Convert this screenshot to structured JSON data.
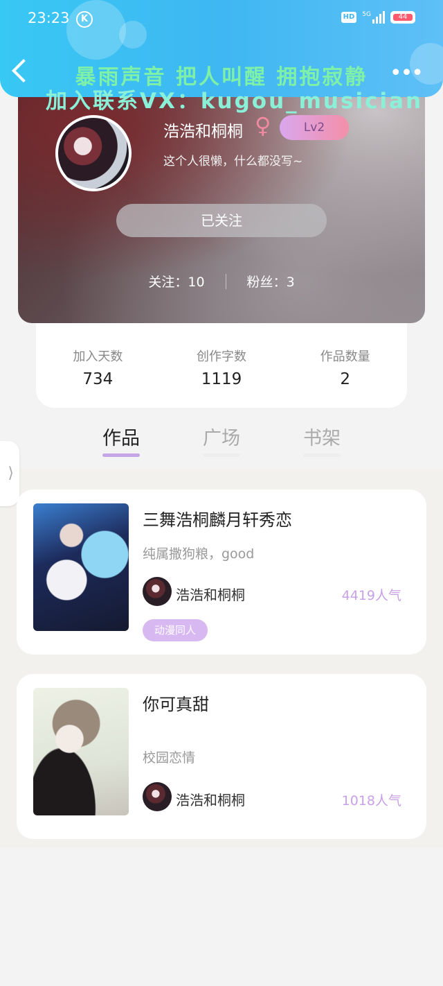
{
  "status_bar": {
    "time": "23:23",
    "k_badge": "K",
    "hd_label": "HD",
    "network": "5G",
    "battery": "44"
  },
  "header": {
    "song_marquee": "暴雨声音 把人叫醒 拥抱寂静",
    "promo_text": "加入联系VX：kugou_musician"
  },
  "profile": {
    "username": "浩浩和桐桐",
    "gender_symbol": "♀",
    "level": "Lv2",
    "bio": "这个人很懒，什么都没写~",
    "follow_button": "已关注",
    "following_label": "关注：",
    "following_count": "10",
    "fans_label": "粉丝：",
    "fans_count": "3"
  },
  "stats": [
    {
      "label": "加入天数",
      "value": "734"
    },
    {
      "label": "创作字数",
      "value": "1119"
    },
    {
      "label": "作品数量",
      "value": "2"
    }
  ],
  "tabs": [
    {
      "label": "作品",
      "active": true
    },
    {
      "label": "广场",
      "active": false
    },
    {
      "label": "书架",
      "active": false
    }
  ],
  "side_handle": "⟩",
  "works": [
    {
      "title": "三舞浩桐麟月轩秀恋",
      "description": "纯属撒狗粮，good",
      "author": "浩浩和桐桐",
      "popularity": "4419人气",
      "tag": "动漫同人"
    },
    {
      "title": "你可真甜",
      "description": "校园恋情",
      "author": "浩浩和桐桐",
      "popularity": "1018人气"
    }
  ],
  "colors": {
    "top_bar": "#3fb7f2",
    "accent_purple": "#c8a0e6",
    "level_badge": "#f48fa8"
  }
}
